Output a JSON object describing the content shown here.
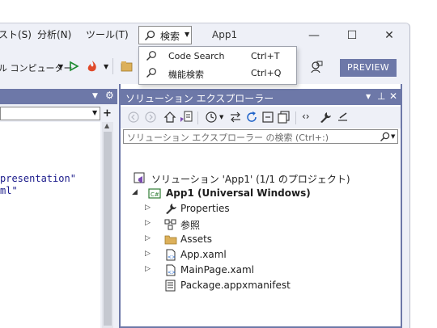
{
  "menu": {
    "items": [
      "スト(S)",
      "分析(N)",
      "ツール(T)"
    ],
    "search_label": "検索",
    "app_title": "App1"
  },
  "window_controls": {
    "minimize": "—",
    "maximize": "☐",
    "close": "✕"
  },
  "toolbar": {
    "run_target": "ル コンピューター",
    "preview_label": "PREVIEW"
  },
  "search_popup": {
    "items": [
      {
        "label": "Code Search",
        "shortcut": "Ctrl+T"
      },
      {
        "label": "機能検索",
        "shortcut": "Ctrl+Q"
      }
    ]
  },
  "editor": {
    "lines": [
      "presentation\"",
      "ml\""
    ]
  },
  "solution_explorer": {
    "title": "ソリューション エクスプローラー",
    "search_placeholder": "ソリューション エクスプローラー の検索 (Ctrl+:)",
    "tree": [
      {
        "label": "ソリューション 'App1' (1/1 のプロジェクト)",
        "icon": "solution-icon",
        "expander": ""
      },
      {
        "label": "App1 (Universal Windows)",
        "icon": "csharp-project-icon",
        "expander": "◢",
        "bold": true
      },
      {
        "label": "Properties",
        "icon": "wrench-icon",
        "expander": "▷"
      },
      {
        "label": "参照",
        "icon": "references-icon",
        "expander": "▷"
      },
      {
        "label": "Assets",
        "icon": "folder-icon",
        "expander": "▷"
      },
      {
        "label": "App.xaml",
        "icon": "xaml-file-icon",
        "expander": "▷"
      },
      {
        "label": "MainPage.xaml",
        "icon": "xaml-file-icon",
        "expander": "▷"
      },
      {
        "label": "Package.appxmanifest",
        "icon": "manifest-icon",
        "expander": ""
      }
    ]
  }
}
